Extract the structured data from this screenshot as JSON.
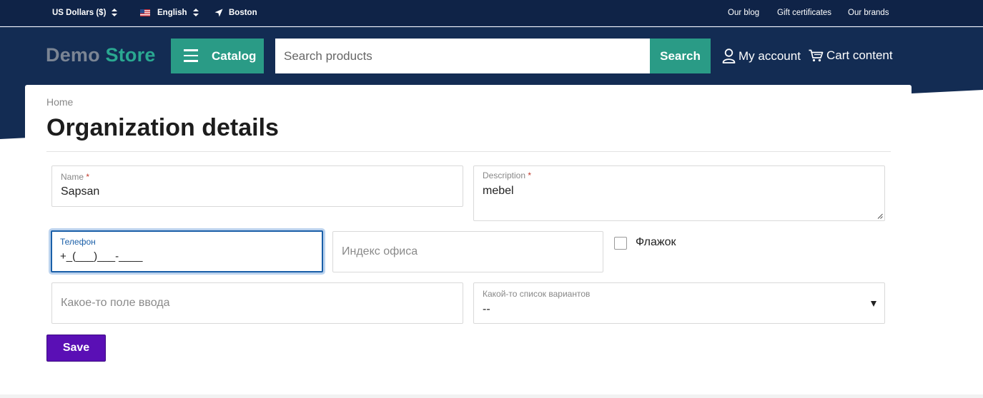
{
  "topbar": {
    "currency": "US Dollars ($)",
    "language": "English",
    "location": "Boston",
    "links": [
      "Our blog",
      "Gift certificates",
      "Our brands"
    ]
  },
  "header": {
    "logo_part1": "Demo",
    "logo_part2": "Store",
    "catalog_label": "Catalog",
    "search_placeholder": "Search products",
    "search_button": "Search",
    "account_label": "My account",
    "cart_label": "Cart content"
  },
  "page": {
    "breadcrumb": "Home",
    "title": "Organization details"
  },
  "form": {
    "name": {
      "label": "Name",
      "required_mark": "*",
      "value": "Sapsan"
    },
    "description": {
      "label": "Description",
      "required_mark": "*",
      "value": "mebel"
    },
    "phone": {
      "label": "Телефон",
      "value": "+_(___)___-____"
    },
    "office_index": {
      "placeholder": "Индекс офиса"
    },
    "flag": {
      "label": "Флажок",
      "checked": false
    },
    "some_input": {
      "placeholder": "Какое-то поле ввода"
    },
    "some_select": {
      "label": "Какой-то список вариантов",
      "value": "--"
    },
    "save_label": "Save"
  },
  "colors": {
    "topbar_bg": "#0f2347",
    "header_bg": "#132c53",
    "accent": "#2a9b86",
    "save_button": "#5a0fb5",
    "focus_border": "#1a5fa8"
  }
}
